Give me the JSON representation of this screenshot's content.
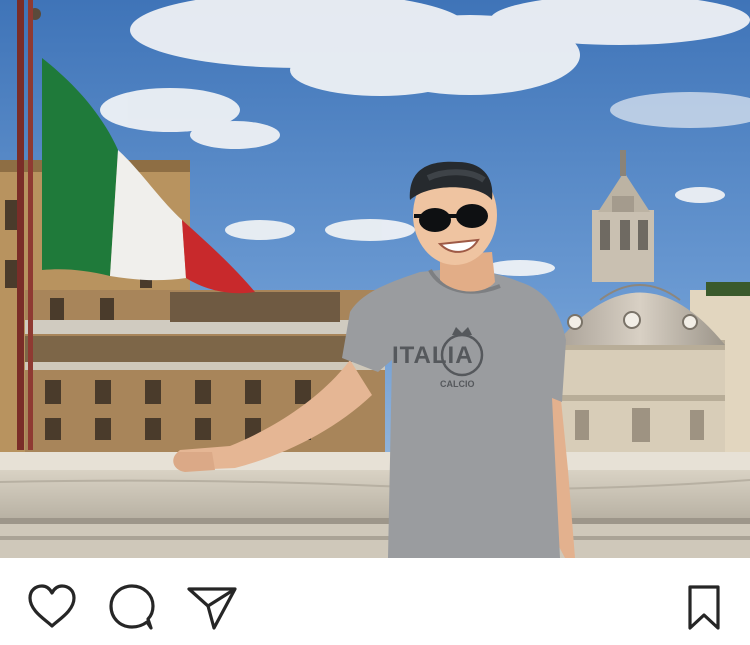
{
  "post": {
    "photo": {
      "shirt_text": "ITALIA",
      "shirt_subtext": "CALCIO"
    },
    "actions": {
      "like_icon": "heart-icon",
      "comment_icon": "comment-icon",
      "share_icon": "send-icon",
      "save_icon": "bookmark-icon"
    }
  },
  "colors": {
    "sky": "#5b8fcf",
    "flag_green": "#1f7a3a",
    "flag_white": "#f2f2f0",
    "flag_red": "#c8292c",
    "shirt": "#9a9c9f",
    "icon": "#262626",
    "background": "#ffffff"
  }
}
